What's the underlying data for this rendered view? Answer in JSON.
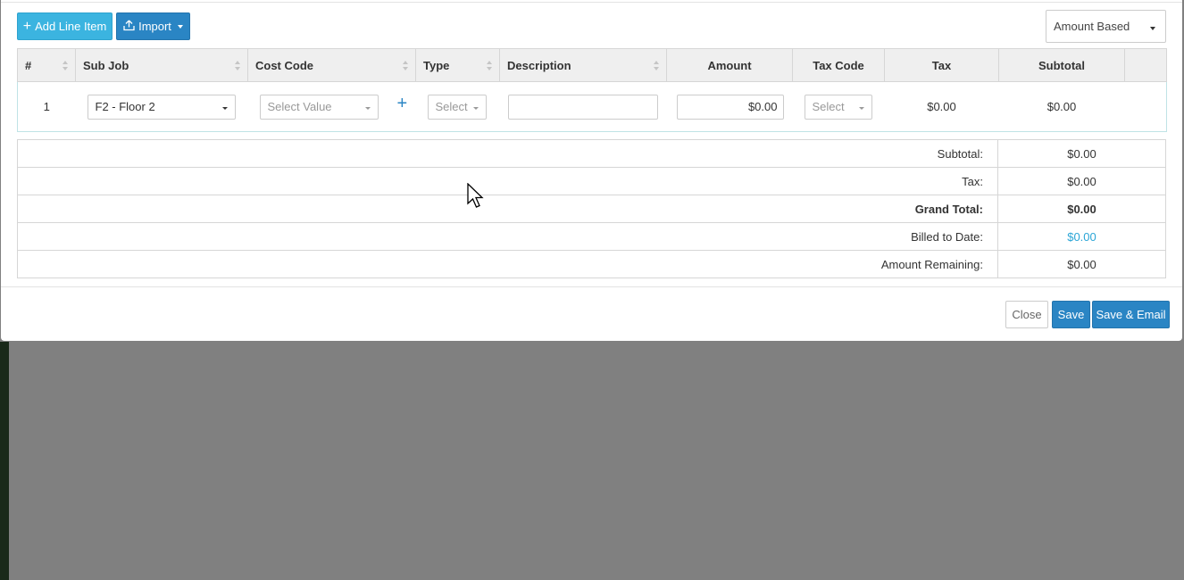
{
  "toolbar": {
    "add_line_item_label": "Add Line Item",
    "import_label": "Import",
    "billing_mode_value": "Amount Based"
  },
  "grid": {
    "headers": {
      "num": "#",
      "sub_job": "Sub Job",
      "cost_code": "Cost Code",
      "type": "Type",
      "description": "Description",
      "amount": "Amount",
      "tax_code": "Tax Code",
      "tax": "Tax",
      "subtotal": "Subtotal"
    },
    "rows": [
      {
        "num": "1",
        "sub_job": "F2 - Floor 2",
        "cost_code_placeholder": "Select Value",
        "type_placeholder": "Select",
        "description": "",
        "amount": "$0.00",
        "tax_code_placeholder": "Select",
        "tax": "$0.00",
        "subtotal": "$0.00"
      }
    ]
  },
  "totals": {
    "subtotal_label": "Subtotal:",
    "subtotal_value": "$0.00",
    "tax_label": "Tax:",
    "tax_value": "$0.00",
    "grand_total_label": "Grand Total:",
    "grand_total_value": "$0.00",
    "billed_label": "Billed to Date:",
    "billed_value": "$0.00",
    "remaining_label": "Amount Remaining:",
    "remaining_value": "$0.00"
  },
  "footer": {
    "close_label": "Close",
    "save_label": "Save",
    "save_email_label": "Save & Email"
  },
  "colors": {
    "primary": "#2a85c4",
    "info": "#3bb4e0",
    "link": "#2ba5d6",
    "overlay": "#808080"
  }
}
